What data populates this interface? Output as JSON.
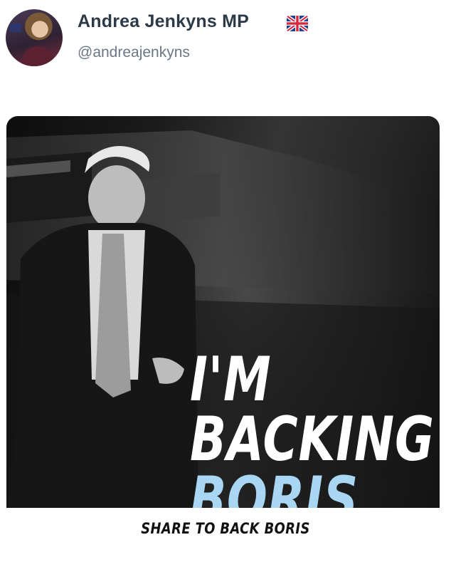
{
  "tweet": {
    "author_name": "Andrea Jenkyns MP",
    "author_handle": "@andreajenkyns",
    "flag_icon": "uk-flag-icon"
  },
  "media": {
    "headline_line1": "I'M",
    "headline_line2": "BACKING",
    "headline_line3": "BORIS",
    "caption": "SHARE TO BACK BORIS",
    "colors": {
      "headline_white": "#ffffff",
      "headline_accent": "#a9d6f2"
    }
  }
}
